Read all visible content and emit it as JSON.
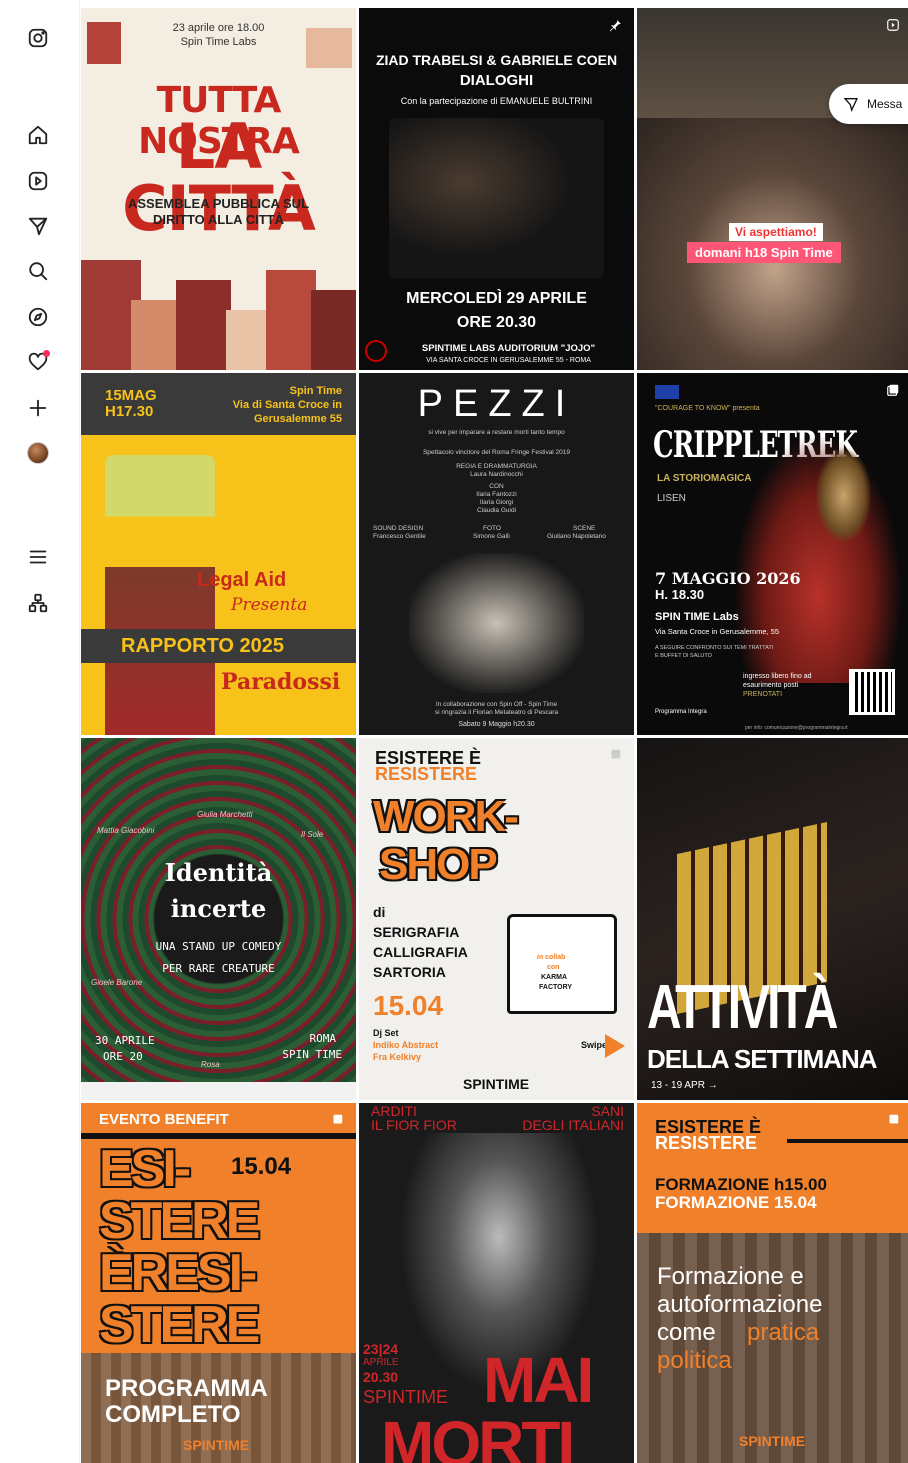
{
  "sidebar": {
    "items": [
      {
        "name": "instagram-logo-icon"
      },
      {
        "name": "home-icon"
      },
      {
        "name": "reels-icon"
      },
      {
        "name": "messages-icon"
      },
      {
        "name": "search-icon"
      },
      {
        "name": "explore-icon"
      },
      {
        "name": "notifications-icon"
      },
      {
        "name": "create-icon"
      },
      {
        "name": "profile-avatar"
      },
      {
        "name": "more-menu-icon"
      },
      {
        "name": "also-from-meta-icon"
      }
    ]
  },
  "messages_button": {
    "label": "Messa"
  },
  "posts": {
    "p1": {
      "date": "23 aprile ore 18.00",
      "venue": "Spin Time Labs",
      "title1": "TUTTA NOSTRA",
      "title2": "LA CITTÀ",
      "sub1": "ASSEMBLEA PUBBLICA SUL",
      "sub2": "DIRITTO ALLA CITTÀ"
    },
    "p2": {
      "title1": "ZIAD TRABELSI & GABRIELE COEN",
      "title2": "DIALOGHI",
      "credit": "Con la partecipazione di EMANUELE BULTRINI",
      "date": "MERCOLEDÌ 29 APRILE",
      "time": "ORE 20.30",
      "venue": "SPINTIME LABS  AUDITORIUM \"JOJO\"",
      "address": "VIA SANTA CROCE IN GERUSALEMME 55 - ROMA"
    },
    "p3": {
      "caption1": "Vi aspettiamo!",
      "caption2": "domani h18 Spin Time"
    },
    "p4": {
      "date": "15MAG",
      "time": "H17.30",
      "venue1": "Spin Time",
      "venue2": "Via di Santa Croce in",
      "venue3": "Gerusalemme 55",
      "org": "Legal Aid",
      "presents": "Presenta",
      "title": "RAPPORTO 2025",
      "subtitle": "Paradossi"
    },
    "p5": {
      "title": "PEZZI",
      "tagline": "si vive per imparare a restare morti tanto tempo",
      "award": "Spettacolo vincitore del Roma Fringe Festival 2019",
      "direction_label": "REGIA E DRAMMATURGIA",
      "director": "Laura Nardinocchi",
      "cast_label": "CON",
      "cast1": "Ilaria Fantozzi",
      "cast2": "Ilaria Giorgi",
      "cast3": "Claudia Guidi",
      "sound_label": "SOUND DESIGN",
      "sound": "Francesco Gentile",
      "photo_label": "FOTO",
      "photo": "Simone Galli",
      "scene_label": "SCENE",
      "scene": "Giuliano Napoletano",
      "collab": "In collaborazione con Spin Off - Spin Time",
      "thanks": "si ringrazia il Florian Metateatro di Pescara",
      "date": "Sabato 9 Maggio h20.30"
    },
    "p6": {
      "program": "\"COURAGE TO KNOW\" presenta",
      "title": "CRIPPLETREK",
      "subtitle": "LA STORIOMAGICA",
      "brand": "LISEN",
      "date": "7 MAGGIO 2026",
      "time": "H. 18.30",
      "venue": "SPIN TIME Labs",
      "address": "Via Santa Croce in Gerusalemme, 55",
      "note1": "A SEGUIRE CONFRONTO SUI TEMI TRATTATI",
      "note2": "E BUFFET DI SALUTO",
      "entry1": "ingresso libero fino ad",
      "entry2": "esaurimento posti",
      "entry3": "PRENOTATI",
      "footer_logo": "Programma Integra",
      "info": "per info: comunicazione@programmaintegra.it"
    },
    "p7": {
      "name1": "Mattia Giacobini",
      "name2": "Giulia Marchetti",
      "name3": "Il Sole",
      "title1": "Identità",
      "title2": "incerte",
      "sub1": "UNA STAND UP COMEDY",
      "sub2": "PER RARE CREATURE",
      "name4": "Gioele Barone",
      "name5": "Rosa",
      "date1": "30 APRILE",
      "date2": "ORE 20",
      "place1": "ROMA",
      "place2": "SPIN TIME"
    },
    "p8": {
      "head1": "ESISTERE È",
      "head2": "RESISTERE",
      "title1": "WORK-",
      "title2": "SHOP",
      "di": "di",
      "item1": "SERIGRAFIA",
      "item2": "CALLIGRAFIA",
      "item3": "SARTORIA",
      "date": "15.04",
      "dj": "Dj Set",
      "dj1": "Indiko Abstract",
      "dj2": "Fra Kelkivy",
      "shirt1": "in collab",
      "shirt2": "con",
      "shirt3": "KARMA",
      "shirt4": "FACTORY",
      "swipe": "Swipe",
      "footer": "SPINTIME"
    },
    "p9": {
      "title1": "ATTIVITÀ",
      "title2": "DELLA SETTIMANA",
      "dates": "13 - 19 APR →"
    },
    "p10": {
      "badge": "EVENTO BENEFIT",
      "date": "15.04",
      "l1": "ESI-",
      "l2": "STERE",
      "l3": "ÈRESI-",
      "l4": "STERE",
      "program1": "PROGRAMMA",
      "program2": "COMPLETO",
      "footer": "SPINTIME"
    },
    "p11": {
      "top1": "ARDITI",
      "top2": "IL FIOR FIOR",
      "top3": "SANI",
      "top4": "DEGLI ITALIANI",
      "date1": "23|24",
      "date2": "APRILE",
      "time": "20.30",
      "venue": "SPINTIME",
      "title1": "MAI",
      "title2": "MORTI"
    },
    "p12": {
      "head1": "ESISTERE È",
      "head2": "RESISTERE",
      "time1": "FORMAZIONE h15.00",
      "time2": "FORMAZIONE 15.04",
      "body1": "Formazione e",
      "body2": "autoformazione",
      "body3": "come",
      "body4": "pratica",
      "body5": "politica",
      "footer": "SPINTIME"
    }
  }
}
